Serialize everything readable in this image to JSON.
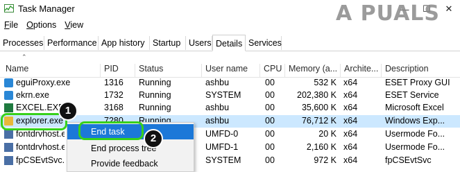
{
  "window": {
    "title": "Task Manager",
    "minimize_icon": "minimize-icon",
    "maximize_icon": "maximize-icon",
    "close_icon": "close-icon"
  },
  "watermark": "A  PUALS",
  "menu": [
    {
      "label": "File",
      "mnemonic": "F",
      "rest": "ile"
    },
    {
      "label": "Options",
      "mnemonic": "O",
      "rest": "ptions"
    },
    {
      "label": "View",
      "mnemonic": "V",
      "rest": "iew"
    }
  ],
  "tabs": [
    "Processes",
    "Performance",
    "App history",
    "Startup",
    "Users",
    "Details",
    "Services"
  ],
  "active_tab": "Details",
  "columns": [
    "Name",
    "PID",
    "Status",
    "User name",
    "CPU",
    "Memory (a...",
    "Archite...",
    "Description"
  ],
  "rows": [
    {
      "name": "eguiProxy.exe",
      "pid": "1316",
      "status": "Running",
      "user": "ashbu",
      "cpu": "00",
      "memory": "532 K",
      "arch": "x64",
      "desc": "ESET Proxy GUI",
      "icon": "eset-icon",
      "color": "#2a87d6"
    },
    {
      "name": "ekrn.exe",
      "pid": "1732",
      "status": "Running",
      "user": "SYSTEM",
      "cpu": "00",
      "memory": "202,380 K",
      "arch": "x64",
      "desc": "ESET Service",
      "icon": "eset-icon",
      "color": "#2a87d6"
    },
    {
      "name": "EXCEL.EXE",
      "pid": "3168",
      "status": "Running",
      "user": "ashbu",
      "cpu": "00",
      "memory": "35,600 K",
      "arch": "x64",
      "desc": "Microsoft Excel",
      "icon": "excel-icon",
      "color": "#1f7a3f"
    },
    {
      "name": "explorer.exe",
      "pid": "7280",
      "status": "Running",
      "user": "ashbu",
      "cpu": "00",
      "memory": "76,712 K",
      "arch": "x64",
      "desc": "Windows Exp...",
      "icon": "folder-icon",
      "color": "#e8b83a",
      "selected": true
    },
    {
      "name": "fontdrvhost.exe",
      "pid": "",
      "status": "",
      "user": "UMFD-0",
      "cpu": "00",
      "memory": "20 K",
      "arch": "x64",
      "desc": "Usermode Fo...",
      "icon": "app-icon",
      "color": "#4a6fa5"
    },
    {
      "name": "fontdrvhost.exe",
      "pid": "",
      "status": "",
      "user": "UMFD-1",
      "cpu": "00",
      "memory": "2,160 K",
      "arch": "x64",
      "desc": "Usermode Fo...",
      "icon": "app-icon",
      "color": "#4a6fa5"
    },
    {
      "name": "fpCSEvtSvc.exe",
      "pid": "",
      "status": "",
      "user": "SYSTEM",
      "cpu": "00",
      "memory": "972 K",
      "arch": "x64",
      "desc": "fpCSEvtSvc",
      "icon": "app-icon",
      "color": "#4a6fa5"
    }
  ],
  "context_menu": [
    "End task",
    "End process tree",
    "Provide feedback"
  ],
  "badges": [
    "1",
    "2"
  ],
  "highlight_color": "#37d11a"
}
